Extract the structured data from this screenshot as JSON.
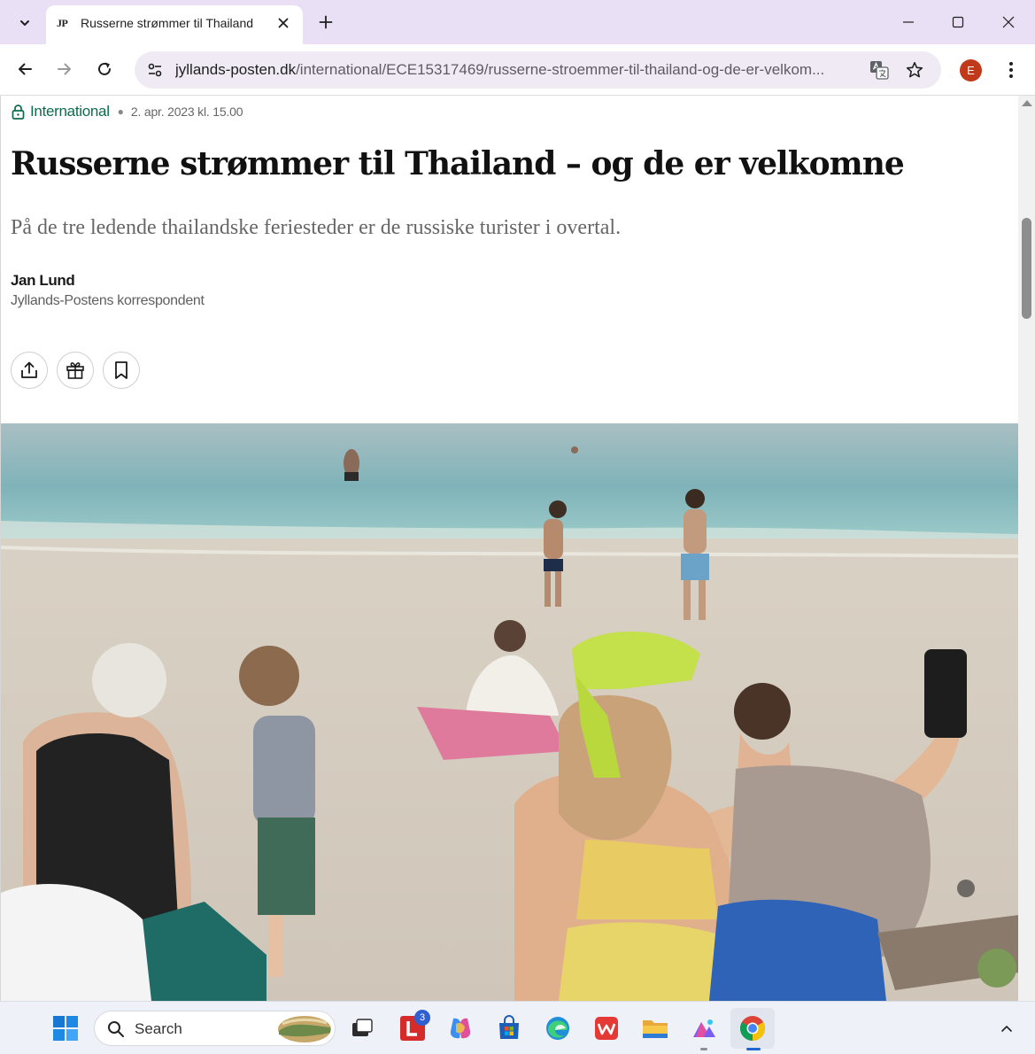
{
  "browser": {
    "tab_title": "Russerne strømmer til Thailand",
    "tab_favicon": "JP",
    "url_domain": "jyllands-posten.dk",
    "url_path": "/international/ECE15317469/russerne-stroemmer-til-thailand-og-de-er-velkom...",
    "profile_initial": "E"
  },
  "article": {
    "section": "International",
    "date": "2. apr. 2023 kl. 15.00",
    "headline": "Russerne strømmer til Thailand – og de er velkomne",
    "lead": "På de tre ledende thailandske feriesteder er de russiske turister i overtal.",
    "author": "Jan Lund",
    "author_role": "Jyllands-Postens korrespondent"
  },
  "taskbar": {
    "search_placeholder": "Search",
    "mail_badge_count": "3"
  },
  "colors": {
    "section_green": "#0d6b4c",
    "titlebar": "#e9e0f5",
    "taskbar": "#eef1f8"
  }
}
